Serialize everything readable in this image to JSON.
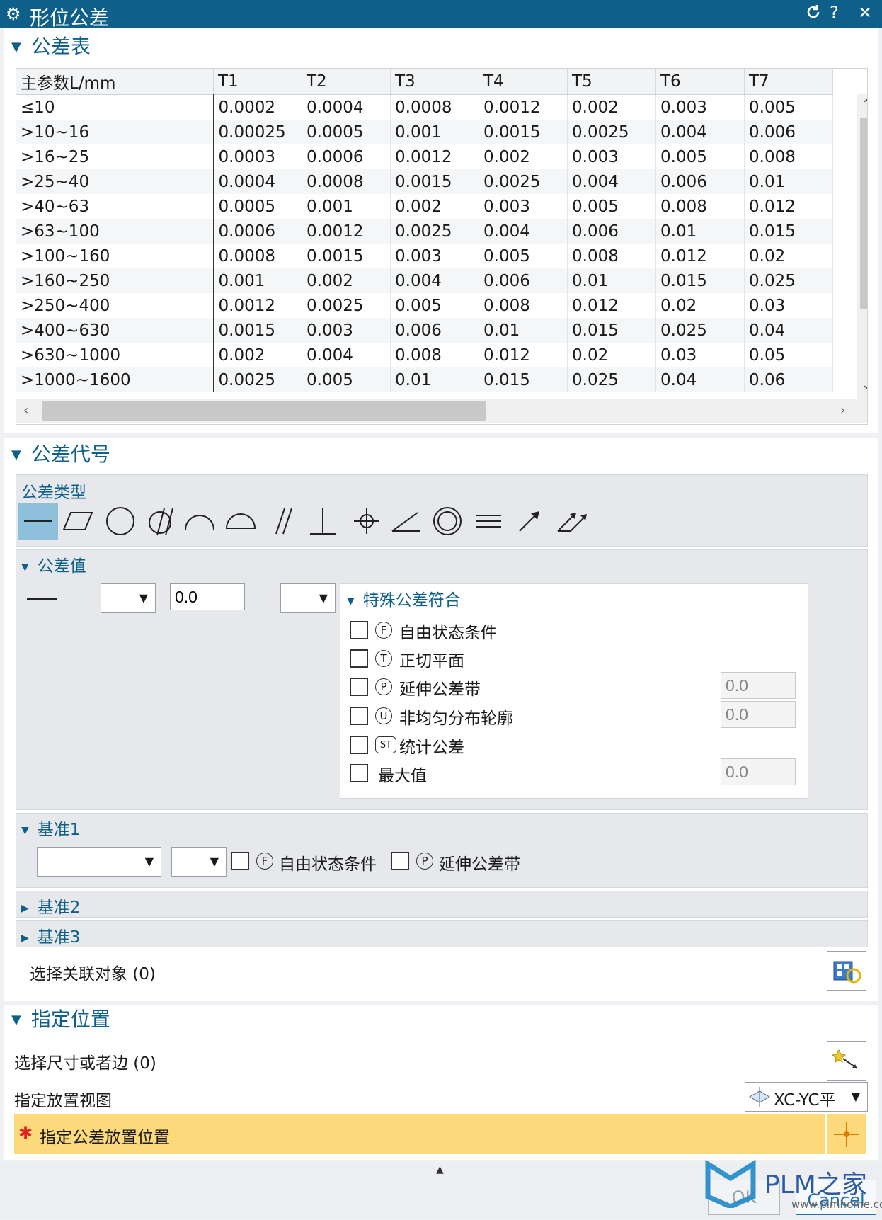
{
  "window": {
    "title": "形位公差",
    "reset_icon": "reset-icon",
    "help_label": "?",
    "close_label": "✕"
  },
  "tolerance_table": {
    "section_title": "公差表",
    "columns": [
      "主参数L/mm",
      "T1",
      "T2",
      "T3",
      "T4",
      "T5",
      "T6",
      "T7"
    ],
    "rows": [
      [
        "≤10",
        "0.0002",
        "0.0004",
        "0.0008",
        "0.0012",
        "0.002",
        "0.003",
        "0.005"
      ],
      [
        ">10~16",
        "0.00025",
        "0.0005",
        "0.001",
        "0.0015",
        "0.0025",
        "0.004",
        "0.006"
      ],
      [
        ">16~25",
        "0.0003",
        "0.0006",
        "0.0012",
        "0.002",
        "0.003",
        "0.005",
        "0.008"
      ],
      [
        ">25~40",
        "0.0004",
        "0.0008",
        "0.0015",
        "0.0025",
        "0.004",
        "0.006",
        "0.01"
      ],
      [
        ">40~63",
        "0.0005",
        "0.001",
        "0.002",
        "0.003",
        "0.005",
        "0.008",
        "0.012"
      ],
      [
        ">63~100",
        "0.0006",
        "0.0012",
        "0.0025",
        "0.004",
        "0.006",
        "0.01",
        "0.015"
      ],
      [
        ">100~160",
        "0.0008",
        "0.0015",
        "0.003",
        "0.005",
        "0.008",
        "0.012",
        "0.02"
      ],
      [
        ">160~250",
        "0.001",
        "0.002",
        "0.004",
        "0.006",
        "0.01",
        "0.015",
        "0.025"
      ],
      [
        ">250~400",
        "0.0012",
        "0.0025",
        "0.005",
        "0.008",
        "0.012",
        "0.02",
        "0.03"
      ],
      [
        ">400~630",
        "0.0015",
        "0.003",
        "0.006",
        "0.01",
        "0.015",
        "0.025",
        "0.04"
      ],
      [
        ">630~1000",
        "0.002",
        "0.004",
        "0.008",
        "0.012",
        "0.02",
        "0.03",
        "0.05"
      ],
      [
        ">1000~1600",
        "0.0025",
        "0.005",
        "0.01",
        "0.015",
        "0.025",
        "0.04",
        "0.06"
      ]
    ]
  },
  "tolerance_code": {
    "section_title": "公差代号",
    "type_group_title": "公差类型",
    "types": [
      "straightness-icon",
      "flatness-icon",
      "circularity-icon",
      "cylindricity-icon",
      "line-profile-icon",
      "surface-profile-icon",
      "parallelism-icon",
      "perpendicularity-icon",
      "position-icon",
      "angularity-icon",
      "concentricity-icon",
      "symmetry-icon",
      "circular-runout-icon",
      "total-runout-icon"
    ],
    "selected_type": "straightness-icon",
    "value_group_title": "公差值",
    "value": "0.0",
    "special": {
      "title": "特殊公差符合",
      "items": [
        {
          "symbol": "F",
          "label": "自由状态条件",
          "value": ""
        },
        {
          "symbol": "T",
          "label": "正切平面",
          "value": ""
        },
        {
          "symbol": "P",
          "label": "延伸公差带",
          "value": "0.0"
        },
        {
          "symbol": "U",
          "label": "非均匀分布轮廓",
          "value": "0.0"
        },
        {
          "symbol": "ST",
          "label": "统计公差",
          "value": ""
        },
        {
          "symbol": "",
          "label": "最大值",
          "value": "0.0"
        }
      ]
    },
    "datum1": {
      "title": "基准1",
      "free_symbol": "F",
      "free_label": "自由状态条件",
      "proj_symbol": "P",
      "proj_label": "延伸公差带"
    },
    "datum2": {
      "title": "基准2"
    },
    "datum3": {
      "title": "基准3"
    },
    "select_objects_label": "选择关联对象 (0)"
  },
  "placement": {
    "section_title": "指定位置",
    "select_dim_label": "选择尺寸或者边 (0)",
    "view_label": "指定放置视图",
    "view_value": "XC-YC平",
    "origin_label": "指定公差放置位置"
  },
  "footer": {
    "ok_label": "OK",
    "cancel_label": "Cancel",
    "brand": "PLM之家",
    "brand_url": "www.plmhome.com"
  },
  "colors": {
    "titlebar": "#0e5f8a",
    "accent": "#0e5f8a",
    "highlight": "#fcd97a",
    "selected": "#8ec0db"
  }
}
